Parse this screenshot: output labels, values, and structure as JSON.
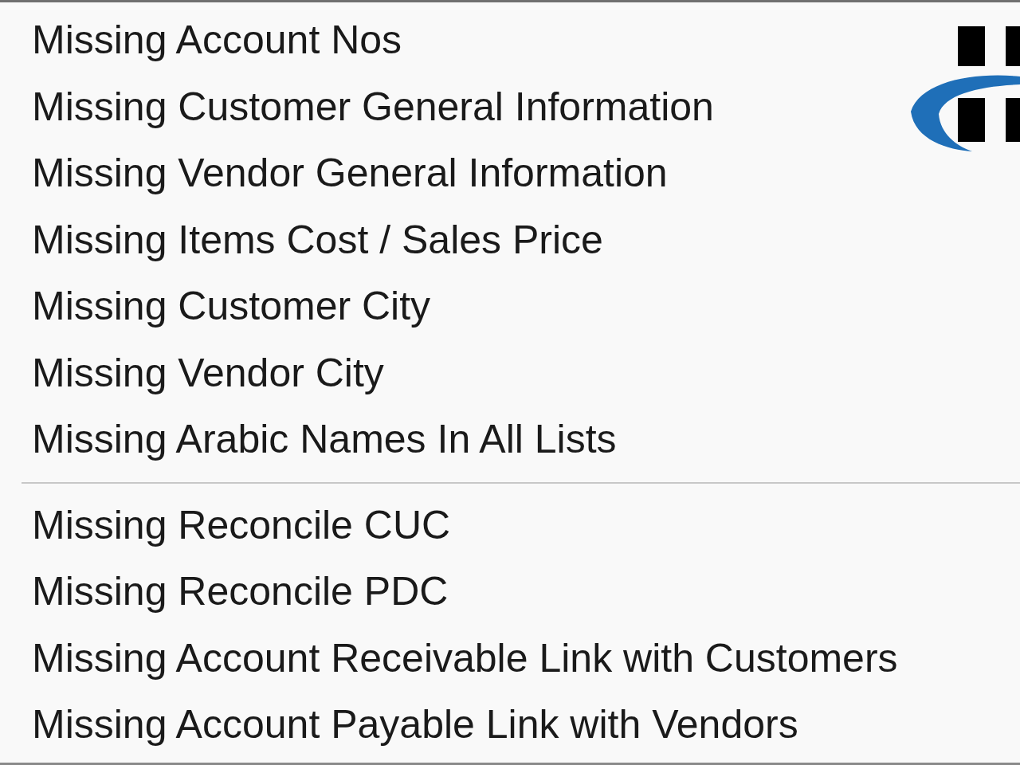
{
  "menu": {
    "groups": [
      {
        "items": [
          "Missing Account Nos",
          "Missing Customer General Information",
          "Missing Vendor General Information",
          "Missing Items Cost / Sales Price",
          "Missing Customer City",
          "Missing Vendor City",
          "Missing Arabic Names In All Lists"
        ]
      },
      {
        "items": [
          "Missing Reconcile CUC",
          "Missing Reconcile PDC",
          "Missing Account Receivable Link with Customers",
          "Missing Account Payable Link with Vendors"
        ]
      }
    ]
  }
}
